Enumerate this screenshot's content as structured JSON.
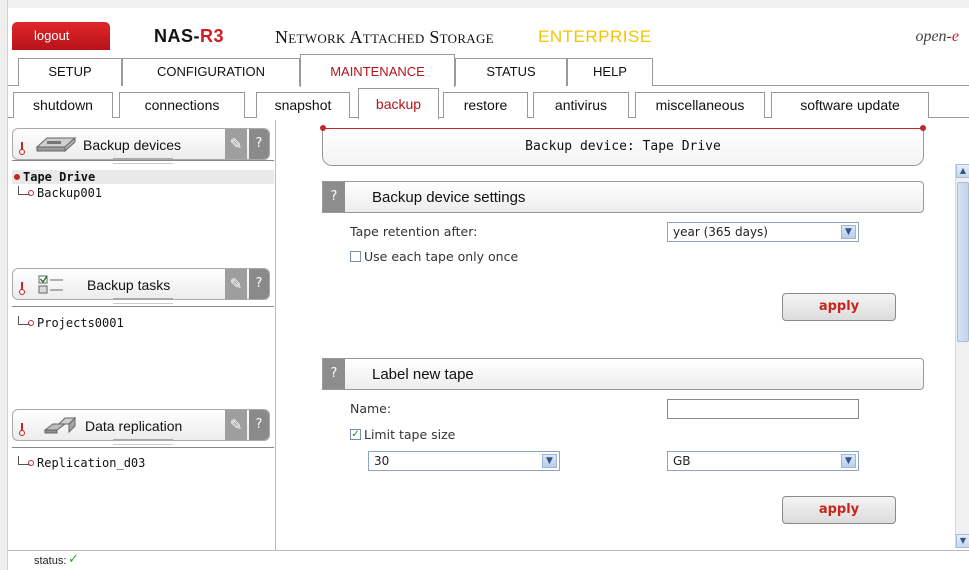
{
  "header": {
    "logout_label": "logout",
    "product_prefix": "NAS-",
    "product_suffix": "R3",
    "subtitle": "Network Attached Storage",
    "edition": "ENTERPRISE",
    "brand_prefix": "open-",
    "brand_suffix": "e"
  },
  "main_tabs": [
    {
      "label": "SETUP"
    },
    {
      "label": "CONFIGURATION"
    },
    {
      "label": "MAINTENANCE",
      "active": true
    },
    {
      "label": "STATUS"
    },
    {
      "label": "HELP"
    }
  ],
  "sub_tabs": [
    {
      "label": "shutdown"
    },
    {
      "label": "connections"
    },
    {
      "label": "snapshot"
    },
    {
      "label": "backup",
      "active": true
    },
    {
      "label": "restore"
    },
    {
      "label": "antivirus"
    },
    {
      "label": "miscellaneous"
    },
    {
      "label": "software update"
    }
  ],
  "left_panel": {
    "backup_devices": {
      "title": "Backup devices",
      "items": [
        "Tape Drive",
        "Backup001"
      ],
      "selected": "Tape Drive"
    },
    "backup_tasks": {
      "title": "Backup tasks",
      "items": [
        "Projects0001"
      ]
    },
    "data_replication": {
      "title": "Data replication",
      "items": [
        "Replication_d03"
      ]
    },
    "help_glyph": "?"
  },
  "content": {
    "device_title": "Backup device: Tape Drive",
    "settings": {
      "title": "Backup device settings",
      "retention_label": "Tape retention after:",
      "retention_value": "year (365 days)",
      "once_label": "Use each tape only once",
      "once_checked": false,
      "apply_label": "apply"
    },
    "label_tape": {
      "title": "Label new tape",
      "name_label": "Name:",
      "name_value": "",
      "limit_label": "Limit tape size",
      "limit_checked": true,
      "size_value": "30",
      "unit_value": "GB",
      "apply_label": "apply"
    }
  },
  "status": {
    "label": "status:"
  },
  "colors": {
    "accent_red": "#c1272d",
    "edition_yellow": "#f5c400",
    "status_green": "#2fa22f"
  }
}
